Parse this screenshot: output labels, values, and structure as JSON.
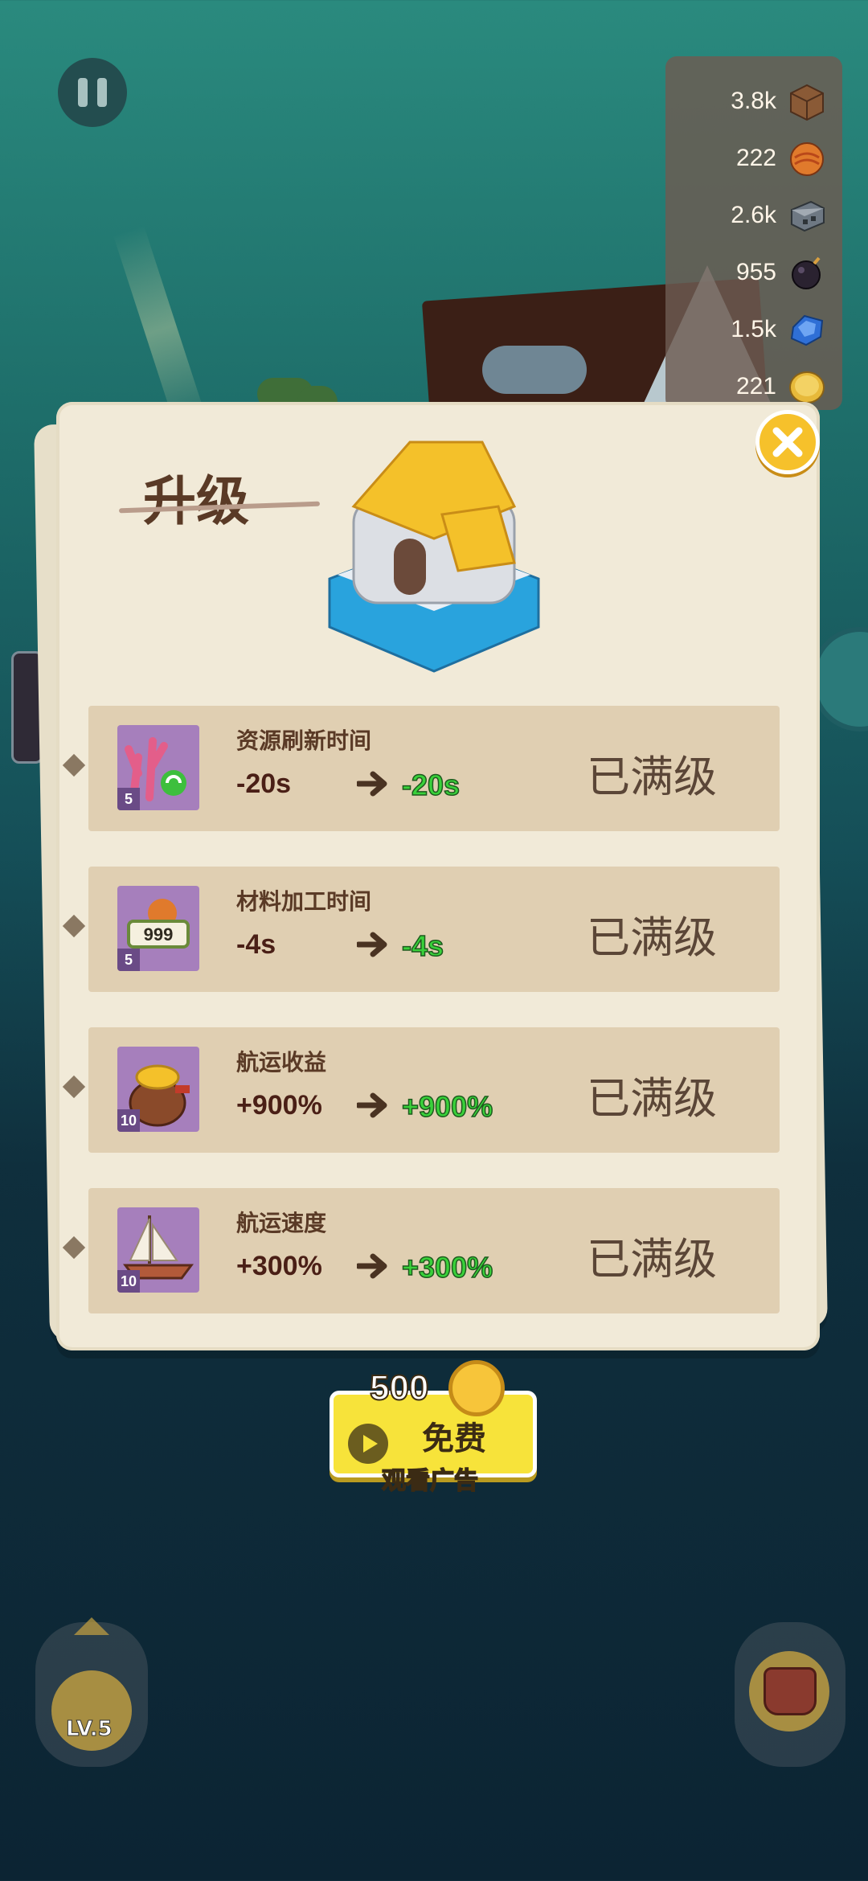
{
  "colors": {
    "accent_green": "#39d13a",
    "paper": "#f1ead8",
    "row_bg": "#e0cfb2",
    "icon_bg": "#a67fbc",
    "close_button": "#f6c12b",
    "ad_button": "#f7e33a"
  },
  "resources": [
    {
      "value": "3.8k",
      "icon": "wood-crate-icon"
    },
    {
      "value": "222",
      "icon": "orange-fruit-icon"
    },
    {
      "value": "2.6k",
      "icon": "iron-ingot-icon"
    },
    {
      "value": "955",
      "icon": "bomb-icon"
    },
    {
      "value": "1.5k",
      "icon": "blue-gem-icon"
    },
    {
      "value": "221",
      "icon": "gold-coin-icon"
    }
  ],
  "dialog": {
    "title": "升级",
    "close_icon": "close-icon",
    "building_icon": "gold-roof-tower-icon"
  },
  "upgrades": [
    {
      "name": "资源刷新时间",
      "level": "5",
      "from": "-20s",
      "to": "-20s",
      "status": "已满级",
      "icon": "coral-refresh-icon"
    },
    {
      "name": "材料加工时间",
      "level": "5",
      "from": "-4s",
      "to": "-4s",
      "status": "已满级",
      "icon": "processing-999-icon"
    },
    {
      "name": "航运收益",
      "level": "10",
      "from": "+900%",
      "to": "+900%",
      "status": "已满级",
      "icon": "gold-sack-icon"
    },
    {
      "name": "航运速度",
      "level": "10",
      "from": "+300%",
      "to": "+300%",
      "status": "已满级",
      "icon": "sailboat-icon"
    }
  ],
  "ad_button": {
    "amount": "500",
    "free_label": "免费",
    "watch_label": "观看广告"
  },
  "bottom": {
    "fishing_level": "LV.5"
  }
}
